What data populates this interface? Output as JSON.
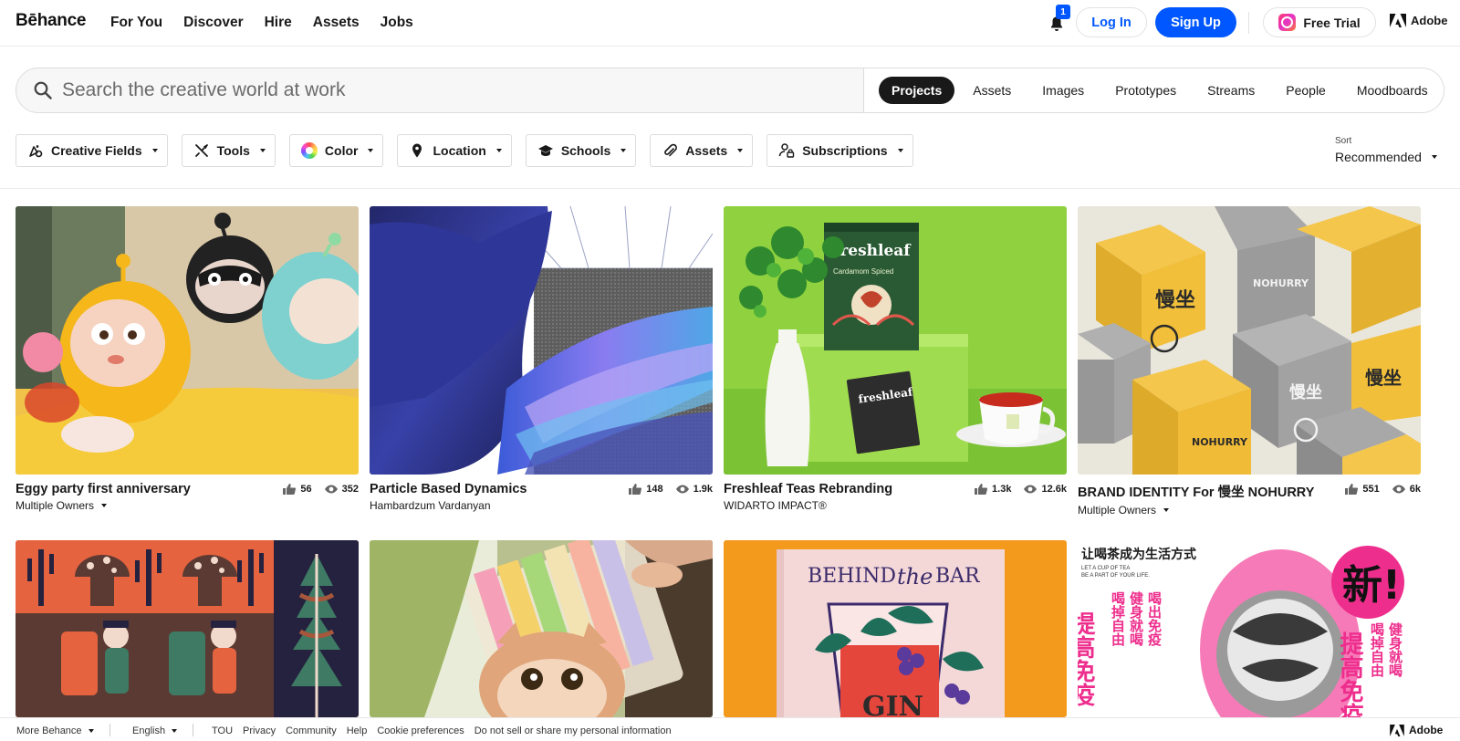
{
  "brand": {
    "logo": "Bēhance",
    "adobe": "Adobe"
  },
  "nav": {
    "links": [
      "For You",
      "Discover",
      "Hire",
      "Assets",
      "Jobs"
    ],
    "notification_count": "1",
    "login": "Log In",
    "signup": "Sign Up",
    "trial": "Free Trial"
  },
  "search": {
    "placeholder": "Search the creative world at work",
    "tabs": [
      "Projects",
      "Assets",
      "Images",
      "Prototypes",
      "Streams",
      "People",
      "Moodboards"
    ],
    "active_tab": "Projects"
  },
  "filters": [
    "Creative Fields",
    "Tools",
    "Color",
    "Location",
    "Schools",
    "Assets",
    "Subscriptions"
  ],
  "sort": {
    "label": "Sort",
    "value": "Recommended"
  },
  "projects": [
    {
      "title": "Eggy party first anniversary",
      "owner": "Multiple Owners",
      "owner_dropdown": true,
      "likes": "56",
      "views": "352"
    },
    {
      "title": "Particle Based Dynamics",
      "owner": "Hambardzum Vardanyan",
      "owner_dropdown": false,
      "likes": "148",
      "views": "1.9k"
    },
    {
      "title": "Freshleaf Teas Rebranding",
      "owner": "WIDARTO IMPACT®",
      "owner_dropdown": false,
      "likes": "1.3k",
      "views": "12.6k"
    },
    {
      "title": "BRAND IDENTITY For 慢坐 NOHURRY",
      "owner": "Multiple Owners",
      "owner_dropdown": true,
      "likes": "551",
      "views": "6k"
    }
  ],
  "thumb_text": {
    "freshleaf_box": "freshleaf",
    "freshleaf_sub": "Cardamom Spiced",
    "nohurry_box": "NOHURRY",
    "nohurry_chars": "慢坐",
    "bar_title_a": "BEHIND",
    "bar_title_b": "the",
    "bar_title_c": "BAR",
    "bar_gin": "GIN",
    "poster_head": "让喝茶成为生活方式",
    "poster_sub_1": "LET A CUP OF TEA",
    "poster_sub_2": "BE A PART OF YOUR LIFE.",
    "poster_new": "新!",
    "poster_col_1": "提高免疫",
    "poster_col_2": "喝掉自由",
    "poster_col_3": "健身就喝",
    "poster_col_4": "喝出免疫"
  },
  "footer": {
    "more": "More Behance",
    "language": "English",
    "links": [
      "TOU",
      "Privacy",
      "Community",
      "Help",
      "Cookie preferences",
      "Do not sell or share my personal information"
    ],
    "adobe": "Adobe"
  },
  "colors": {
    "accent": "#0057ff",
    "text": "#191919",
    "border": "#dcdcdc"
  }
}
